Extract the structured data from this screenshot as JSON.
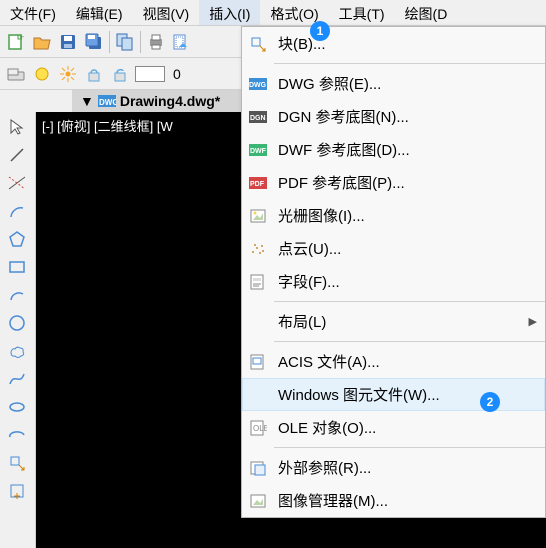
{
  "menubar": {
    "file": "文件(F)",
    "edit": "编辑(E)",
    "view": "视图(V)",
    "insert": "插入(I)",
    "format": "格式(O)",
    "tools": "工具(T)",
    "draw": "绘图(D"
  },
  "toolbar2": {
    "zero": "0"
  },
  "doc": {
    "tab_marker": "▼",
    "filename": "Drawing4.dwg*"
  },
  "canvas": {
    "status": "[-] [俯视] [二维线框] [W"
  },
  "dropdown": {
    "block": "块(B)...",
    "dwg_ref": "DWG 参照(E)...",
    "dgn_ref": "DGN 参考底图(N)...",
    "dwf_ref": "DWF 参考底图(D)...",
    "pdf_ref": "PDF 参考底图(P)...",
    "raster": "光栅图像(I)...",
    "pointcloud": "点云(U)...",
    "field": "字段(F)...",
    "layout": "布局(L)",
    "acis": "ACIS 文件(A)...",
    "wmf": "Windows 图元文件(W)...",
    "ole": "OLE 对象(O)...",
    "xref": "外部参照(R)...",
    "imgmgr": "图像管理器(M)..."
  },
  "badges": {
    "one": "1",
    "two": "2"
  }
}
